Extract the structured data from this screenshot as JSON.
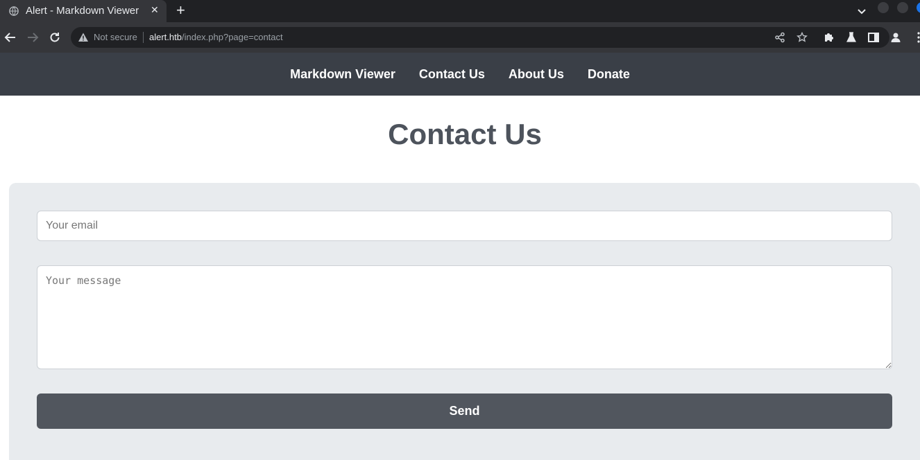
{
  "browser": {
    "tab_title": "Alert - Markdown Viewer",
    "security_label": "Not secure",
    "url_host": "alert.htb",
    "url_path": "/index.php?page=contact"
  },
  "nav": {
    "items": [
      {
        "label": "Markdown Viewer"
      },
      {
        "label": "Contact Us"
      },
      {
        "label": "About Us"
      },
      {
        "label": "Donate"
      }
    ]
  },
  "page": {
    "title": "Contact Us"
  },
  "form": {
    "email_placeholder": "Your email",
    "message_placeholder": "Your message",
    "submit_label": "Send"
  }
}
